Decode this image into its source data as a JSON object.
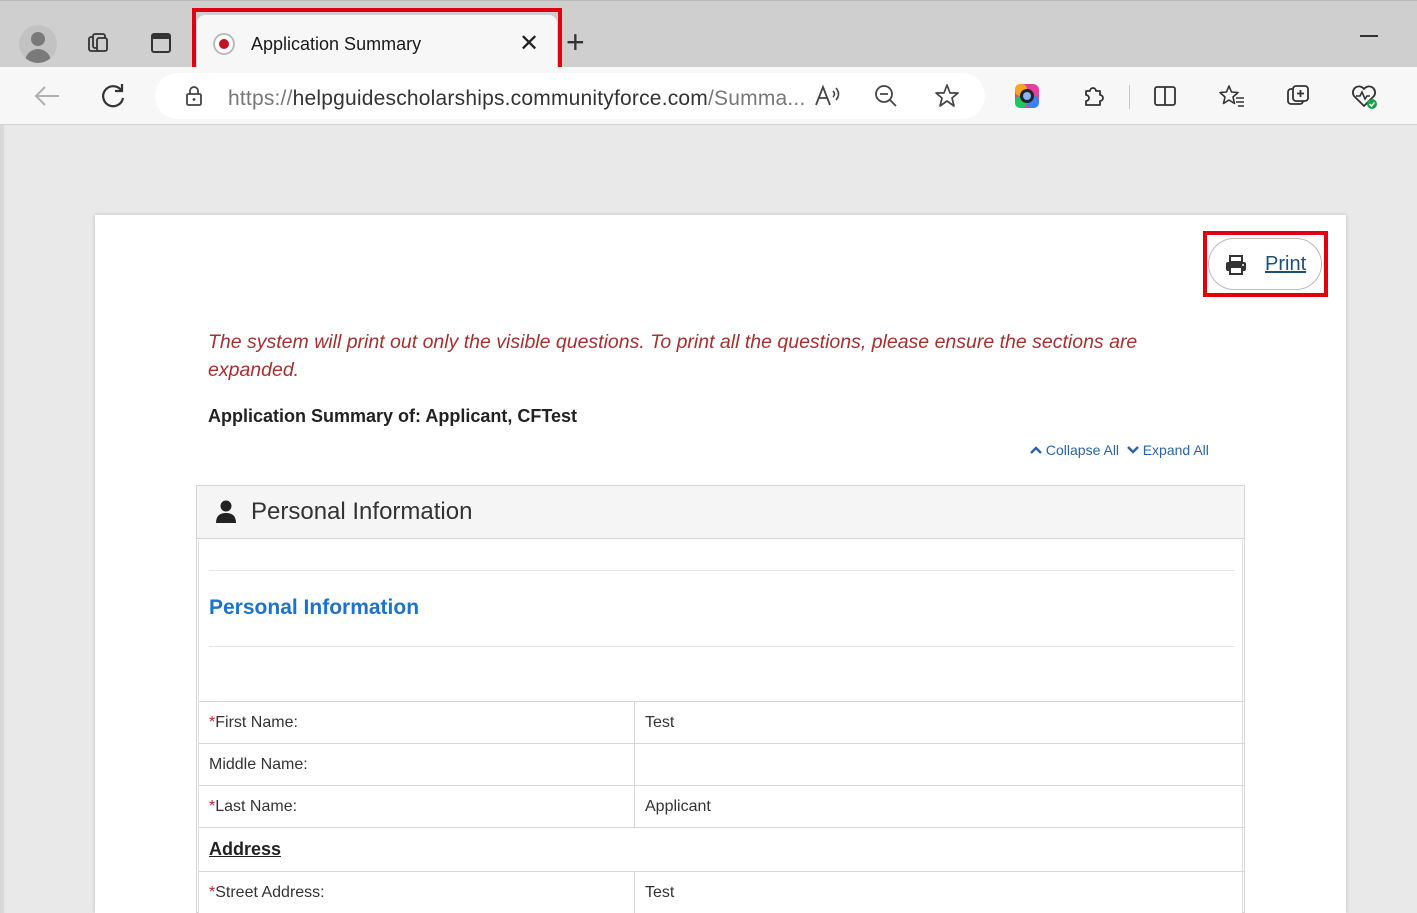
{
  "browser": {
    "tab_title": "Application Summary",
    "tab_close": "✕",
    "new_tab": "+",
    "url_prefix": "https://",
    "url_domain": "helpguidescholarships.communityforce.com",
    "url_rest": "/Summa..."
  },
  "page": {
    "print_label": "Print",
    "notice": "The system will print out only the visible questions. To print all the questions, please ensure the sections are expanded.",
    "summary_title": "Application Summary of: Applicant, CFTest",
    "collapse_all": "Collapse All",
    "expand_all": "Expand All"
  },
  "section": {
    "title": "Personal Information",
    "subtitle": "Personal Information",
    "rows": [
      {
        "required": "*",
        "label": "First Name:",
        "value": "Test"
      },
      {
        "required": "",
        "label": "Middle Name:",
        "value": ""
      },
      {
        "required": "*",
        "label": "Last Name:",
        "value": "Applicant"
      }
    ],
    "address_heading": "Address",
    "address_rows": [
      {
        "required": "*",
        "label": "Street Address:",
        "value": "Test"
      }
    ]
  },
  "colors": {
    "highlight": "#e0000f",
    "notice": "#a5312f",
    "link": "#2a64a8",
    "subtitle": "#1d73c9"
  }
}
